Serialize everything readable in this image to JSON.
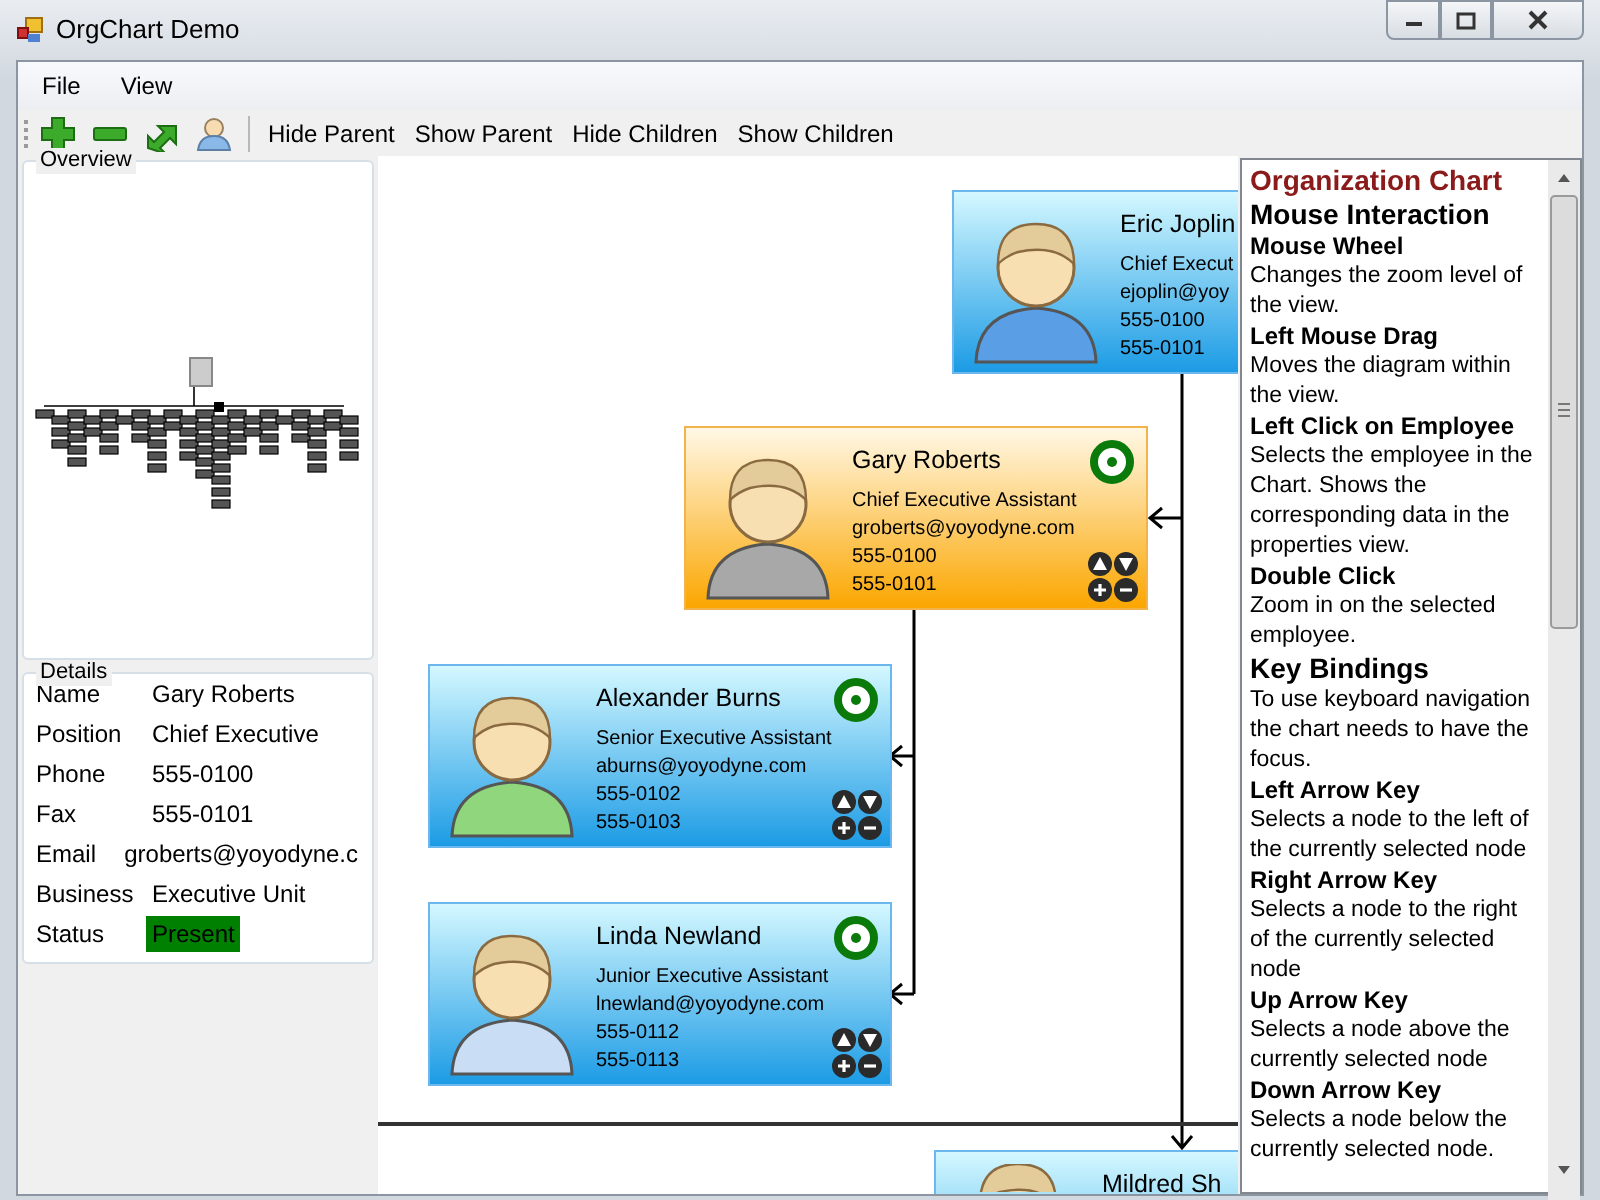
{
  "window": {
    "title": "OrgChart Demo"
  },
  "menu": [
    "File",
    "View"
  ],
  "toolbar": {
    "text_buttons": [
      "Hide Parent",
      "Show Parent",
      "Hide Children",
      "Show Children"
    ]
  },
  "overview": {
    "title": "Overview"
  },
  "details": {
    "title": "Details",
    "rows": [
      {
        "label": "Name",
        "value": "Gary Roberts"
      },
      {
        "label": "Position",
        "value": "Chief Executive"
      },
      {
        "label": "Phone",
        "value": "555-0100"
      },
      {
        "label": "Fax",
        "value": "555-0101"
      },
      {
        "label": "Email",
        "value": "groberts@yoyodyne.c"
      },
      {
        "label": "Business",
        "value": "Executive Unit"
      },
      {
        "label": "Status",
        "value": "Present",
        "color": "#008000"
      }
    ]
  },
  "chart": {
    "nodes": [
      {
        "name": "Eric Joplin",
        "title": "Chief Execut",
        "email": "ejoplin@yoy",
        "phone": "555-0100",
        "fax": "555-0101",
        "selected": false,
        "clipped": true,
        "color": "#5a9fe6"
      },
      {
        "name": "Gary Roberts",
        "title": "Chief Executive Assistant",
        "email": "groberts@yoyodyne.com",
        "phone": "555-0100",
        "fax": "555-0101",
        "selected": true,
        "clipped": false,
        "color": "#a8a8a8"
      },
      {
        "name": "Alexander Burns",
        "title": "Senior Executive Assistant",
        "email": "aburns@yoyodyne.com",
        "phone": "555-0102",
        "fax": "555-0103",
        "selected": false,
        "clipped": false,
        "color": "#8fd67c"
      },
      {
        "name": "Linda Newland",
        "title": "Junior Executive Assistant",
        "email": "lnewland@yoyodyne.com",
        "phone": "555-0112",
        "fax": "555-0113",
        "selected": false,
        "clipped": false,
        "color": "#c9def5"
      },
      {
        "name": "Mildred Sh",
        "selected": false,
        "clipped": true
      }
    ]
  },
  "help": {
    "items": [
      {
        "kind": "title",
        "text": "Organization Chart"
      },
      {
        "kind": "heading",
        "text": "Mouse Interaction"
      },
      {
        "kind": "subheading",
        "text": "Mouse Wheel"
      },
      {
        "kind": "text",
        "text": "Changes the zoom level of the view."
      },
      {
        "kind": "subheading",
        "text": "Left Mouse Drag"
      },
      {
        "kind": "text",
        "text": "Moves the diagram within the view."
      },
      {
        "kind": "subheading",
        "text": "Left Click on Employee"
      },
      {
        "kind": "text",
        "text": "Selects the employee in the Chart. Shows the corresponding data in the properties view."
      },
      {
        "kind": "subheading",
        "text": "Double Click"
      },
      {
        "kind": "text",
        "text": "Zoom in on the selected employee."
      },
      {
        "kind": "heading",
        "text": "Key Bindings"
      },
      {
        "kind": "text",
        "text": "To use keyboard navigation the chart needs to have the focus."
      },
      {
        "kind": "subheading",
        "text": "Left Arrow Key"
      },
      {
        "kind": "text",
        "text": "Selects a node to the left of the currently selected node"
      },
      {
        "kind": "subheading",
        "text": "Right Arrow Key"
      },
      {
        "kind": "text",
        "text": "Selects a node to the right of the currently selected node"
      },
      {
        "kind": "subheading",
        "text": "Up Arrow Key"
      },
      {
        "kind": "text",
        "text": "Selects a node above the currently selected node"
      },
      {
        "kind": "subheading",
        "text": "Down Arrow Key"
      },
      {
        "kind": "text",
        "text": "Selects a node below the currently selected node."
      }
    ]
  }
}
